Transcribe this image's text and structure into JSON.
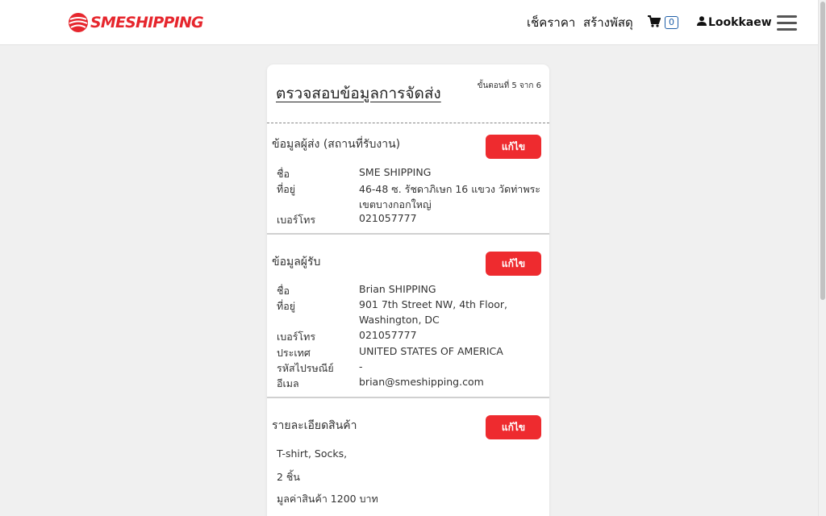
{
  "header": {
    "logo_text": "SMESHIPPING",
    "nav": {
      "check_price": "เช็คราคา",
      "create_parcel": "สร้างพัสดุ",
      "cart_count": "0",
      "user_name": "Lookkaew"
    }
  },
  "card": {
    "title": "ตรวจสอบข้อมูลการจัดส่ง",
    "step": "ขั้นตอนที่ 5 จาก 6",
    "edit_label": "แก้ไข",
    "sender": {
      "title": "ข้อมูลผู้ส่ง (สถานที่รับงาน)",
      "name_label": "ชื่อ",
      "name": "SME SHIPPING",
      "address_label": "ที่อยู่",
      "address_line1": "46-48 ซ. รัชดาภิเษก 16 แขวง วัดท่าพระ",
      "address_line2": "เขตบางกอกใหญ่",
      "phone_label": "เบอร์โทร",
      "phone": "021057777"
    },
    "receiver": {
      "title": "ข้อมูลผู้รับ",
      "name_label": "ชื่อ",
      "name": "Brian SHIPPING",
      "address_label": "ที่อยู่",
      "address_line1": "901 7th Street NW, 4th Floor,",
      "address_line2": "Washington, DC",
      "phone_label": "เบอร์โทร",
      "phone": "021057777",
      "country_label": "ประเทศ",
      "country": "UNITED STATES OF AMERICA",
      "postcode_label": "รหัสไปรษณีย์",
      "postcode": "-",
      "email_label": "อีเมล",
      "email": "brian@smeshipping.com"
    },
    "items": {
      "title": "รายละเอียดสินค้า",
      "description": "T-shirt, Socks,",
      "quantity": "2 ชิ้น",
      "value": "มูลค่าสินค้า 1200 บาท"
    }
  },
  "colors": {
    "brand_red": "#ee2b2f",
    "badge_blue": "#1f5fa8"
  },
  "icons": [
    "globe-logo-icon",
    "cart-icon",
    "user-icon",
    "hamburger-menu-icon"
  ]
}
